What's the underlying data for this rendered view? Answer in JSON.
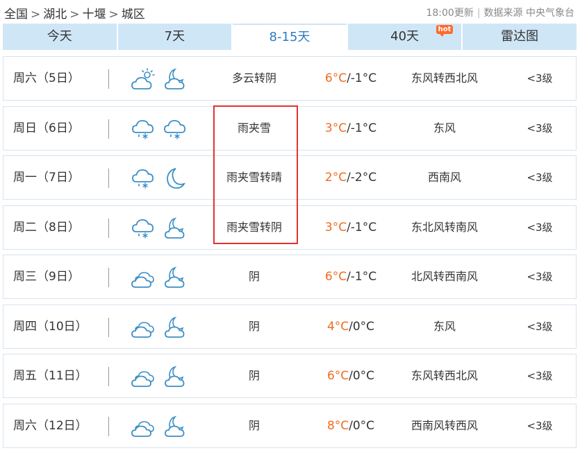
{
  "breadcrumb": {
    "items": [
      "全国",
      "湖北",
      "十堰",
      "城区"
    ],
    "separator": ">"
  },
  "header": {
    "update_time": "18:00更新",
    "source_label": "数据来源",
    "source_name": "中央气象台"
  },
  "tabs": [
    {
      "label": "今天",
      "active": false
    },
    {
      "label": "7天",
      "active": false
    },
    {
      "label": "8-15天",
      "active": true
    },
    {
      "label": "40天",
      "active": false,
      "badge": "hot"
    },
    {
      "label": "雷达图",
      "active": false
    }
  ],
  "forecast": [
    {
      "day": "周六（5日）",
      "icons": [
        "partly-cloudy-day-icon",
        "cloudy-night-icon"
      ],
      "weather": "多云转阴",
      "high": "6°C",
      "low": "/-1°C",
      "wind": "东风转西北风",
      "level": "<3级"
    },
    {
      "day": "周日（6日）",
      "icons": [
        "sleet-icon",
        "sleet-icon"
      ],
      "weather": "雨夹雪",
      "high": "3°C",
      "low": "/-1°C",
      "wind": "东风",
      "level": "<3级"
    },
    {
      "day": "周一（7日）",
      "icons": [
        "sleet-icon",
        "clear-night-icon"
      ],
      "weather": "雨夹雪转晴",
      "high": "2°C",
      "low": "/-2°C",
      "wind": "西南风",
      "level": "<3级"
    },
    {
      "day": "周二（8日）",
      "icons": [
        "sleet-icon",
        "cloudy-night-icon"
      ],
      "weather": "雨夹雪转阴",
      "high": "3°C",
      "low": "/-1°C",
      "wind": "东北风转南风",
      "level": "<3级"
    },
    {
      "day": "周三（9日）",
      "icons": [
        "overcast-icon",
        "cloudy-night-icon"
      ],
      "weather": "阴",
      "high": "6°C",
      "low": "/-1°C",
      "wind": "北风转西南风",
      "level": "<3级"
    },
    {
      "day": "周四（10日）",
      "icons": [
        "overcast-icon",
        "cloudy-night-icon"
      ],
      "weather": "阴",
      "high": "4°C",
      "low": "/0°C",
      "wind": "东风",
      "level": "<3级"
    },
    {
      "day": "周五（11日）",
      "icons": [
        "overcast-icon",
        "cloudy-night-icon"
      ],
      "weather": "阴",
      "high": "6°C",
      "low": "/0°C",
      "wind": "东风转西北风",
      "level": "<3级"
    },
    {
      "day": "周六（12日）",
      "icons": [
        "overcast-icon",
        "cloudy-night-icon"
      ],
      "weather": "阴",
      "high": "8°C",
      "low": "/0°C",
      "wind": "西南风转西风",
      "level": "<3级"
    }
  ],
  "colors": {
    "tab_bg": "#cfe6f6",
    "active_tab_text": "#2a7cc0",
    "temp_high": "#f06a1c",
    "icon_stroke": "#3d8fc6",
    "highlight_box": "#e0322f",
    "hot_badge": "#ff6a2b"
  }
}
